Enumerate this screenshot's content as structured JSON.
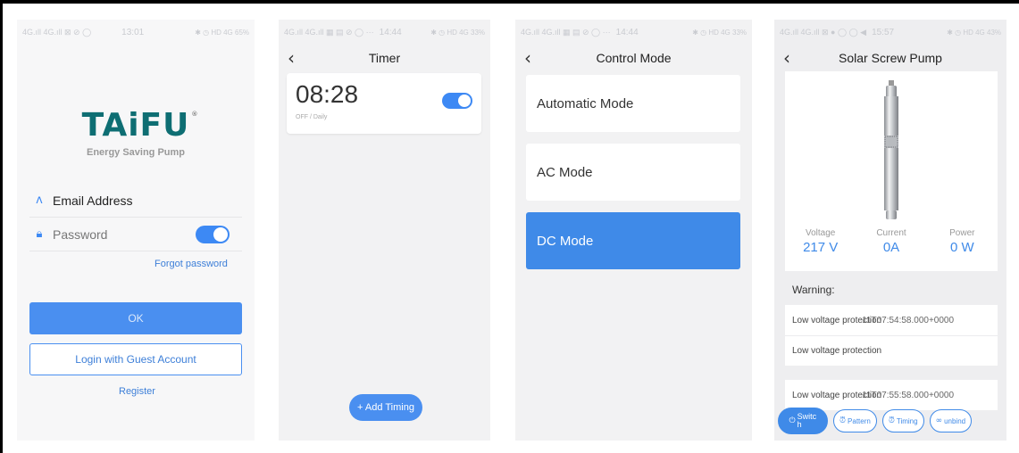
{
  "screens": {
    "login": {
      "status": {
        "left": "4G.ıll 4G.ıll ⊠ ⊘ ◯",
        "time": "13:01",
        "right": "✱ ◷ HD 4G 65%"
      },
      "logo": "TAiFU",
      "logo_mark": "®",
      "tagline": "Energy Saving Pump",
      "email_label": "Email Address",
      "password_label": "Password",
      "forgot": "Forgot password",
      "ok": "OK",
      "guest": "Login with Guest Account",
      "register": "Register"
    },
    "timer": {
      "status": {
        "left": "4G.ıll 4G.ıll ▦ ▤ ⊘ ◯ ···",
        "time": "14:44",
        "right": "✱ ◷ HD 4G 33%"
      },
      "title": "Timer",
      "time": "08:28",
      "schedule": "OFF / Daily",
      "add": "+ Add Timing"
    },
    "control": {
      "status": {
        "left": "4G.ıll 4G.ıll ▦ ▤ ⊘ ◯ ···",
        "time": "14:44",
        "right": "✱ ◷ HD 4G 33%"
      },
      "title": "Control Mode",
      "modes": [
        "Automatic Mode",
        "AC Mode",
        "DC Mode"
      ],
      "active_mode": "DC Mode"
    },
    "pump": {
      "status": {
        "left": "4G.ıll 4G.ıll ⊠ ● ◯ ◯ ◀",
        "time": "15:57",
        "right": "✱ ◷ HD 4G 43%"
      },
      "title": "Solar Screw Pump",
      "metrics": [
        {
          "label": "Voltage",
          "value": "217 V"
        },
        {
          "label": "Current",
          "value": "0A"
        },
        {
          "label": "Power",
          "value": "0 W"
        }
      ],
      "warning_title": "Warning:",
      "warnings": [
        {
          "text": "Low voltage protection",
          "overlap": "11T07:54:58.000+0000"
        },
        {
          "text": "Low voltage protection",
          "overlap": ""
        },
        {
          "text": "Low voltage protection",
          "overlap": "11T07:55:58.000+0000"
        }
      ],
      "actions": {
        "switch": "Switch",
        "pattern": "Pattern",
        "timing": "Timing",
        "unbind": "unbind"
      }
    }
  },
  "colors": {
    "accent": "#3f8ae8",
    "logo": "#0e6e73",
    "background": "#f2f2f3"
  }
}
